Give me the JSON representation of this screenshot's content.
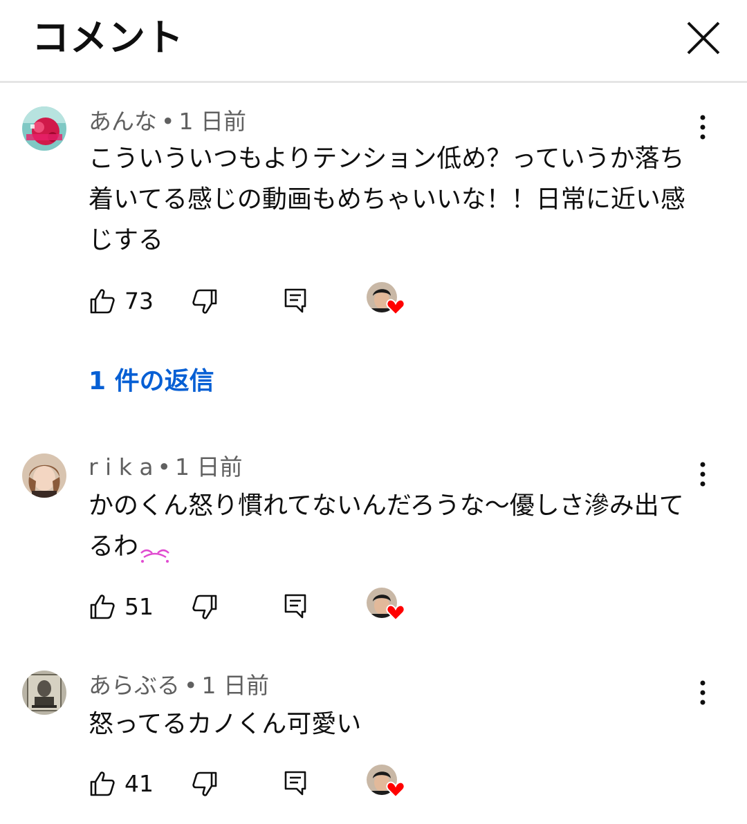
{
  "header": {
    "title": "コメント",
    "close_icon": "close-icon"
  },
  "comments": [
    {
      "author": "あんな",
      "separator": "•",
      "time": "1 日前",
      "text": "こういういつもよりテンション低め？っていうか落ち着いてる感じの動画もめちゃいいな！！日常に近い感じする",
      "likes": "73",
      "replies_label": "1 件の返信"
    },
    {
      "author": "r i k a",
      "separator": "•",
      "time": "1 日前",
      "text": "かのくん怒り慣れてないんだろうな〜優しさ滲み出てるわ",
      "emoji": "🥺",
      "likes": "51"
    },
    {
      "author": "あらぶる",
      "separator": "•",
      "time": "1 日前",
      "text": "怒ってるカノくん可愛い",
      "likes": "41"
    }
  ],
  "colors": {
    "link_blue": "#065fd4",
    "meta_gray": "#606060",
    "heart_red": "#ff0000",
    "divider": "#e5e5e5"
  }
}
